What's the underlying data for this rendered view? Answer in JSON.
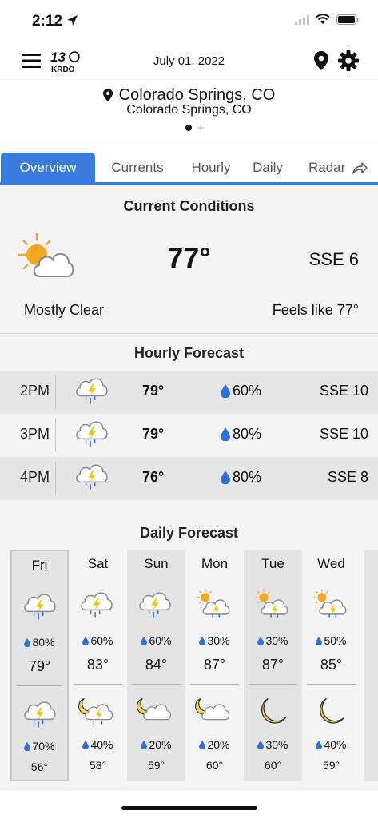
{
  "status": {
    "time": "2:12"
  },
  "header": {
    "logo_number": "13",
    "logo_text": "KRDO",
    "date": "July 01, 2022"
  },
  "location": {
    "title": "Colorado Springs, CO",
    "subtitle": "Colorado Springs, CO"
  },
  "tabs": [
    {
      "label": "Overview",
      "active": true
    },
    {
      "label": "Currents"
    },
    {
      "label": "Hourly"
    },
    {
      "label": "Daily"
    },
    {
      "label": "Radar"
    }
  ],
  "current": {
    "title": "Current Conditions",
    "temp": "77°",
    "wind": "SSE 6",
    "condition": "Mostly Clear",
    "feels_like": "Feels like 77°",
    "icon": "partly-sunny-icon"
  },
  "hourly": {
    "title": "Hourly Forecast",
    "rows": [
      {
        "time": "2PM",
        "temp": "79°",
        "precip": "60%",
        "wind": "SSE 10",
        "icon": "thunderstorm-icon"
      },
      {
        "time": "3PM",
        "temp": "79°",
        "precip": "80%",
        "wind": "SSE 10",
        "icon": "thunderstorm-icon"
      },
      {
        "time": "4PM",
        "temp": "76°",
        "precip": "80%",
        "wind": "SSE 8",
        "icon": "thunderstorm-icon"
      }
    ]
  },
  "daily": {
    "title": "Daily Forecast",
    "days": [
      {
        "name": "Fri",
        "precip": "80%",
        "high": "79°",
        "night_precip": "70%",
        "low": "56°",
        "day_icon": "thunderstorm-icon",
        "night_icon": "thunderstorm-icon"
      },
      {
        "name": "Sat",
        "precip": "60%",
        "high": "83°",
        "night_precip": "40%",
        "low": "58°",
        "day_icon": "thunderstorm-icon",
        "night_icon": "moon-thunderstorm-icon"
      },
      {
        "name": "Sun",
        "precip": "60%",
        "high": "84°",
        "night_precip": "20%",
        "low": "59°",
        "day_icon": "thunderstorm-icon",
        "night_icon": "moon-cloud-icon"
      },
      {
        "name": "Mon",
        "precip": "30%",
        "high": "87°",
        "night_precip": "20%",
        "low": "60°",
        "day_icon": "sun-thunderstorm-icon",
        "night_icon": "moon-cloud-icon"
      },
      {
        "name": "Tue",
        "precip": "30%",
        "high": "87°",
        "night_precip": "30%",
        "low": "60°",
        "day_icon": "sun-thunderstorm-icon",
        "night_icon": "moon-icon"
      },
      {
        "name": "Wed",
        "precip": "50%",
        "high": "85°",
        "night_precip": "40%",
        "low": "59°",
        "day_icon": "sun-thunderstorm-icon",
        "night_icon": "moon-icon"
      }
    ]
  },
  "colors": {
    "accent": "#3a7be0",
    "sun": "#f5a623",
    "rain": "#2f6fd8",
    "moon": "#f7d154"
  }
}
